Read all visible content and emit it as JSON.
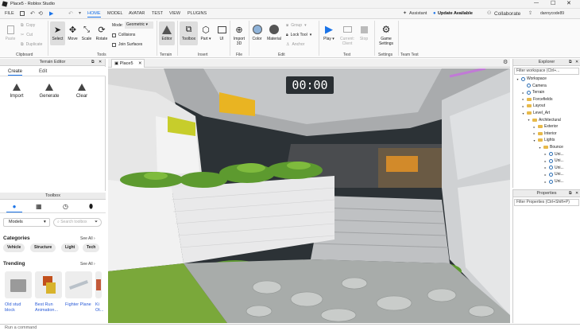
{
  "window": {
    "title": "Place5 - Roblox Studio",
    "app_icon": "roblox-studio-icon"
  },
  "menubar": {
    "file": "FILE",
    "tabs": [
      "HOME",
      "MODEL",
      "AVATAR",
      "TEST",
      "VIEW",
      "PLUGINS"
    ],
    "active_tab": "HOME",
    "assistant": "Assistant",
    "update": "Update Available",
    "collaborate": "Collaborate",
    "username": "dannycode89"
  },
  "ribbon": {
    "clipboard": {
      "paste": "Paste",
      "copy": "Copy",
      "cut": "Cut",
      "duplicate": "Duplicate",
      "group_label": "Clipboard"
    },
    "tools": {
      "select": "Select",
      "move": "Move",
      "scale": "Scale",
      "rotate": "Rotate",
      "mode_label": "Mode:",
      "mode_value": "Geometric",
      "collisions": "Collisions",
      "join_surfaces": "Join Surfaces",
      "group_label": "Tools"
    },
    "terrain": {
      "editor": "Editor",
      "group_label": "Terrain"
    },
    "insert": {
      "toolbox": "Toolbox",
      "part": "Part",
      "ui": "UI",
      "group_label": "Insert"
    },
    "file": {
      "import3d": "Import 3D",
      "group_label": "File"
    },
    "edit": {
      "color": "Color",
      "material": "Material",
      "group": "Group",
      "lock_tool": "Lock Tool",
      "anchor": "Anchor",
      "group_label": "Edit"
    },
    "test": {
      "play": "Play",
      "current_client": "Current: Client",
      "stop": "Stop",
      "group_label": "Test"
    },
    "settings": {
      "game_settings": "Game Settings",
      "group_label": "Settings"
    },
    "team_test": {
      "group_label": "Team Test"
    }
  },
  "terrain_editor": {
    "title": "Terrain Editor",
    "tabs": [
      "Create",
      "Edit"
    ],
    "active_tab": "Create",
    "actions": [
      "Import",
      "Generate",
      "Clear"
    ]
  },
  "toolbox": {
    "title": "Toolbox",
    "category_select": "Models",
    "search_placeholder": "Search toolbox",
    "categories_heading": "Categories",
    "see_all": "See All",
    "category_chips": [
      "Vehicle",
      "Structure",
      "Light",
      "Tech"
    ],
    "trending_heading": "Trending",
    "trending_items": [
      {
        "name": "Old stud block"
      },
      {
        "name": "Best Run Animation..."
      },
      {
        "name": "Fighter Plane"
      },
      {
        "name": "Ki Ot..."
      }
    ]
  },
  "viewport": {
    "tab": "Place5",
    "timer": "00:00"
  },
  "explorer": {
    "title": "Explorer",
    "filter_placeholder": "Filter workspace (Ctrl+...",
    "items": [
      {
        "label": "Workspace",
        "depth": 0,
        "expanded": true,
        "icon": "workspace-icon"
      },
      {
        "label": "Camera",
        "depth": 1,
        "expanded": null,
        "icon": "camera-icon"
      },
      {
        "label": "Terrain",
        "depth": 1,
        "expanded": false,
        "icon": "terrain-icon"
      },
      {
        "label": "Forcefields",
        "depth": 1,
        "expanded": false,
        "icon": "folder-icon"
      },
      {
        "label": "Layout",
        "depth": 1,
        "expanded": false,
        "icon": "folder-icon"
      },
      {
        "label": "Level_Art",
        "depth": 1,
        "expanded": true,
        "icon": "folder-icon"
      },
      {
        "label": "Architectural",
        "depth": 2,
        "expanded": true,
        "icon": "folder-icon"
      },
      {
        "label": "Exterior",
        "depth": 3,
        "expanded": false,
        "icon": "folder-icon"
      },
      {
        "label": "Interior",
        "depth": 3,
        "expanded": false,
        "icon": "folder-icon"
      },
      {
        "label": "Lights",
        "depth": 3,
        "expanded": true,
        "icon": "folder-icon"
      },
      {
        "label": "Bounce",
        "depth": 4,
        "expanded": true,
        "icon": "folder-icon"
      },
      {
        "label": "Uni...",
        "depth": 5,
        "expanded": false,
        "icon": "union-icon"
      },
      {
        "label": "Uni...",
        "depth": 5,
        "expanded": false,
        "icon": "union-icon"
      },
      {
        "label": "Uni...",
        "depth": 5,
        "expanded": false,
        "icon": "union-icon"
      },
      {
        "label": "Uni...",
        "depth": 5,
        "expanded": false,
        "icon": "union-icon"
      },
      {
        "label": "Uni...",
        "depth": 5,
        "expanded": false,
        "icon": "union-icon"
      }
    ]
  },
  "properties": {
    "title": "Properties",
    "filter_placeholder": "Filter Properties (Ctrl+Shift+P)"
  },
  "command_bar": {
    "placeholder": "Run a command"
  },
  "colors": {
    "accent": "#1a73e8",
    "folder": "#e7b94a",
    "timer_bg": "#2a2f33"
  }
}
